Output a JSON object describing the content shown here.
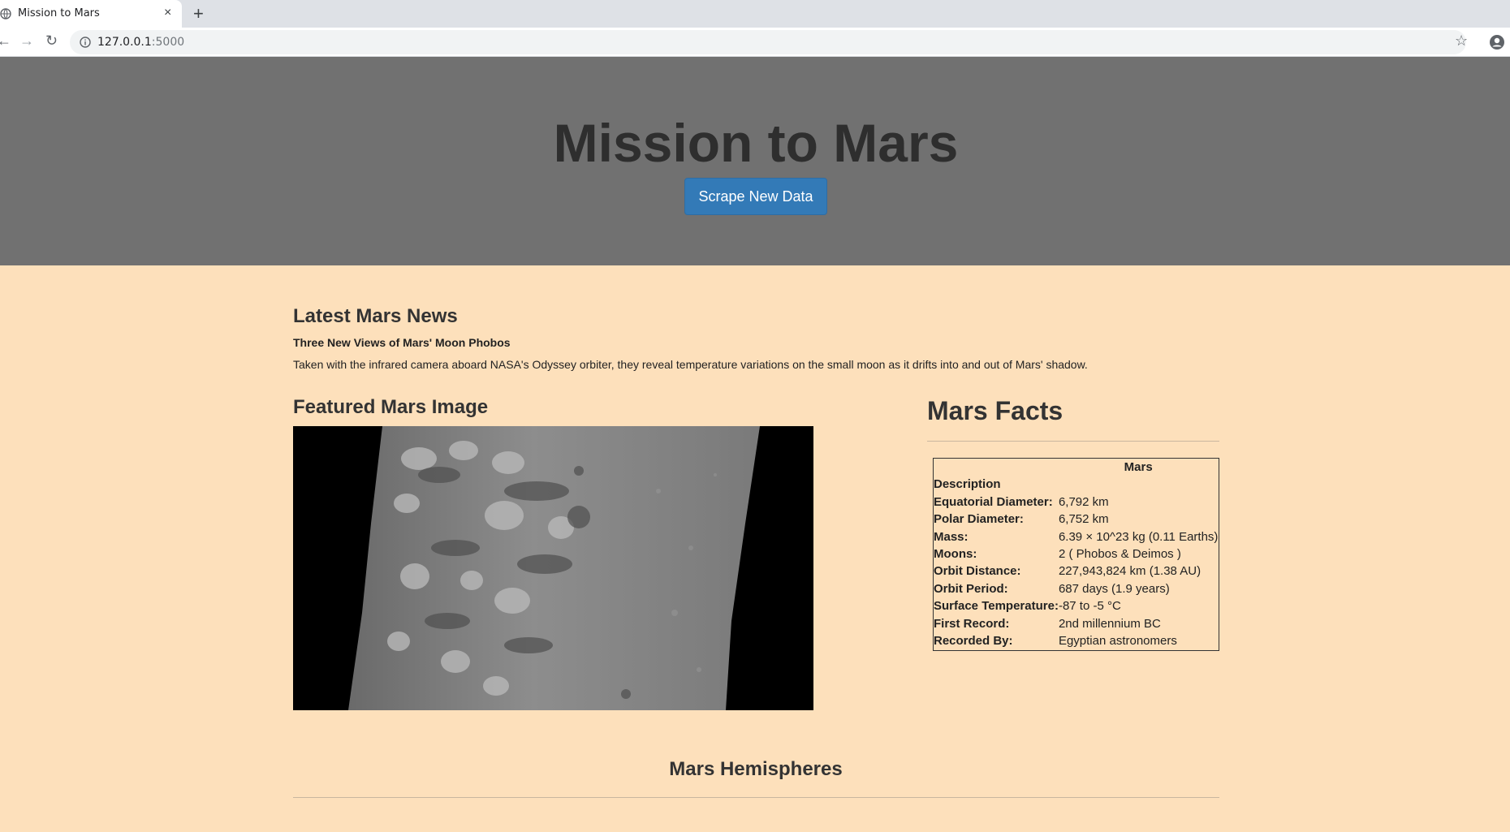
{
  "browser": {
    "tab_title": "Mission to Mars",
    "tab_close": "×",
    "new_tab": "+",
    "url_host": "127.0.0.1",
    "url_port": ":5000"
  },
  "header": {
    "title": "Mission to Mars",
    "scrape_button": "Scrape New Data"
  },
  "news": {
    "header": "Latest Mars News",
    "title": "Three New Views of Mars' Moon Phobos",
    "paragraph": "Taken with the infrared camera aboard NASA's Odyssey orbiter, they reveal temperature variations on the small moon as it drifts into and out of Mars' shadow."
  },
  "featured": {
    "header": "Featured Mars Image"
  },
  "facts": {
    "header": "Mars Facts",
    "column_header": "Mars",
    "index_label": "Description",
    "rows": [
      {
        "label": "Equatorial Diameter:",
        "value": "6,792 km"
      },
      {
        "label": "Polar Diameter:",
        "value": "6,752 km"
      },
      {
        "label": "Mass:",
        "value": "6.39 × 10^23 kg (0.11 Earths)"
      },
      {
        "label": "Moons:",
        "value": "2 ( Phobos & Deimos )"
      },
      {
        "label": "Orbit Distance:",
        "value": "227,943,824 km (1.38 AU)"
      },
      {
        "label": "Orbit Period:",
        "value": "687 days (1.9 years)"
      },
      {
        "label": "Surface Temperature:",
        "value": "-87 to -5 °C"
      },
      {
        "label": "First Record:",
        "value": "2nd millennium BC"
      },
      {
        "label": "Recorded By:",
        "value": "Egyptian astronomers"
      }
    ]
  },
  "hemispheres": {
    "header": "Mars Hemispheres"
  },
  "colors": {
    "page_bg": "#fde0bb",
    "jumbotron_bg": "#717171",
    "button_bg": "#337ab7"
  }
}
